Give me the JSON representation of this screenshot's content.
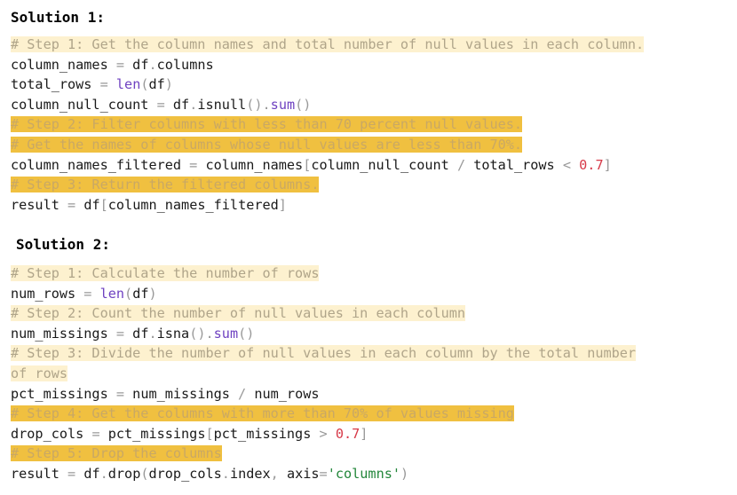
{
  "solution1": {
    "title": "Solution 1:",
    "lines": [
      {
        "kind": "comment",
        "shade": "light",
        "text": "# Step 1: Get the column names and total number of null values in each column."
      },
      {
        "kind": "code",
        "tokens": [
          {
            "t": "column_names "
          },
          {
            "t": "=",
            "c": "op"
          },
          {
            "t": " df"
          },
          {
            "t": ".",
            "c": "op"
          },
          {
            "t": "columns"
          }
        ]
      },
      {
        "kind": "code",
        "tokens": [
          {
            "t": "total_rows "
          },
          {
            "t": "=",
            "c": "op"
          },
          {
            "t": " "
          },
          {
            "t": "len",
            "c": "fn"
          },
          {
            "t": "(",
            "c": "op"
          },
          {
            "t": "df"
          },
          {
            "t": ")",
            "c": "op"
          }
        ]
      },
      {
        "kind": "code",
        "tokens": [
          {
            "t": "column_null_count "
          },
          {
            "t": "=",
            "c": "op"
          },
          {
            "t": " df"
          },
          {
            "t": ".",
            "c": "op"
          },
          {
            "t": "isnull"
          },
          {
            "t": "()",
            "c": "op"
          },
          {
            "t": ".",
            "c": "op"
          },
          {
            "t": "sum",
            "c": "fn"
          },
          {
            "t": "()",
            "c": "op"
          }
        ]
      },
      {
        "kind": "comment",
        "shade": "dark",
        "text": "# Step 2: Filter columns with less than 70 percent null values."
      },
      {
        "kind": "comment",
        "shade": "dark",
        "text": "# Get the names of columns whose null values are less than 70%."
      },
      {
        "kind": "code",
        "tokens": [
          {
            "t": "column_names_filtered "
          },
          {
            "t": "=",
            "c": "op"
          },
          {
            "t": " column_names"
          },
          {
            "t": "[",
            "c": "op"
          },
          {
            "t": "column_null_count "
          },
          {
            "t": "/",
            "c": "op"
          },
          {
            "t": " total_rows "
          },
          {
            "t": "<",
            "c": "op"
          },
          {
            "t": " "
          },
          {
            "t": "0.7",
            "c": "num"
          },
          {
            "t": "]",
            "c": "op"
          }
        ]
      },
      {
        "kind": "comment",
        "shade": "dark",
        "text": "# Step 3: Return the filtered columns."
      },
      {
        "kind": "code",
        "tokens": [
          {
            "t": "result "
          },
          {
            "t": "=",
            "c": "op"
          },
          {
            "t": " df"
          },
          {
            "t": "[",
            "c": "op"
          },
          {
            "t": "column_names_filtered"
          },
          {
            "t": "]",
            "c": "op"
          }
        ]
      }
    ]
  },
  "solution2": {
    "title": "Solution 2:",
    "lines": [
      {
        "kind": "comment",
        "shade": "light",
        "text": "# Step 1: Calculate the number of rows"
      },
      {
        "kind": "code",
        "tokens": [
          {
            "t": "num_rows "
          },
          {
            "t": "=",
            "c": "op"
          },
          {
            "t": " "
          },
          {
            "t": "len",
            "c": "fn"
          },
          {
            "t": "(",
            "c": "op"
          },
          {
            "t": "df"
          },
          {
            "t": ")",
            "c": "op"
          }
        ]
      },
      {
        "kind": "comment",
        "shade": "light",
        "text": "# Step 2: Count the number of null values in each column"
      },
      {
        "kind": "code",
        "tokens": [
          {
            "t": "num_missings "
          },
          {
            "t": "=",
            "c": "op"
          },
          {
            "t": " df"
          },
          {
            "t": ".",
            "c": "op"
          },
          {
            "t": "isna"
          },
          {
            "t": "()",
            "c": "op"
          },
          {
            "t": ".",
            "c": "op"
          },
          {
            "t": "sum",
            "c": "fn"
          },
          {
            "t": "()",
            "c": "op"
          }
        ]
      },
      {
        "kind": "comment",
        "shade": "light",
        "text": "# Step 3: Divide the number of null values in each column by the total number"
      },
      {
        "kind": "comment",
        "shade": "light",
        "text": "of rows"
      },
      {
        "kind": "code",
        "tokens": [
          {
            "t": "pct_missings "
          },
          {
            "t": "=",
            "c": "op"
          },
          {
            "t": " num_missings "
          },
          {
            "t": "/",
            "c": "op"
          },
          {
            "t": " num_rows"
          }
        ]
      },
      {
        "kind": "comment",
        "shade": "dark",
        "text": "# Step 4: Get the columns with more than 70% of values missing"
      },
      {
        "kind": "code",
        "tokens": [
          {
            "t": "drop_cols "
          },
          {
            "t": "=",
            "c": "op"
          },
          {
            "t": " pct_missings"
          },
          {
            "t": "[",
            "c": "op"
          },
          {
            "t": "pct_missings "
          },
          {
            "t": ">",
            "c": "op"
          },
          {
            "t": " "
          },
          {
            "t": "0.7",
            "c": "num"
          },
          {
            "t": "]",
            "c": "op"
          }
        ]
      },
      {
        "kind": "comment",
        "shade": "dark",
        "text": "# Step 5: Drop the columns"
      },
      {
        "kind": "code",
        "tokens": [
          {
            "t": "result "
          },
          {
            "t": "=",
            "c": "op"
          },
          {
            "t": " df"
          },
          {
            "t": ".",
            "c": "op"
          },
          {
            "t": "drop"
          },
          {
            "t": "(",
            "c": "op"
          },
          {
            "t": "drop_cols"
          },
          {
            "t": ".",
            "c": "op"
          },
          {
            "t": "index"
          },
          {
            "t": ", ",
            "c": "op"
          },
          {
            "t": "axis"
          },
          {
            "t": "=",
            "c": "op"
          },
          {
            "t": "'columns'",
            "c": "str"
          },
          {
            "t": ")",
            "c": "op"
          }
        ]
      }
    ]
  },
  "colors": {
    "comment_light_bg": "#fdf1cf",
    "comment_dark_bg": "#f0c040",
    "function": "#6f42c1",
    "number": "#d73a49",
    "string": "#22863a"
  }
}
